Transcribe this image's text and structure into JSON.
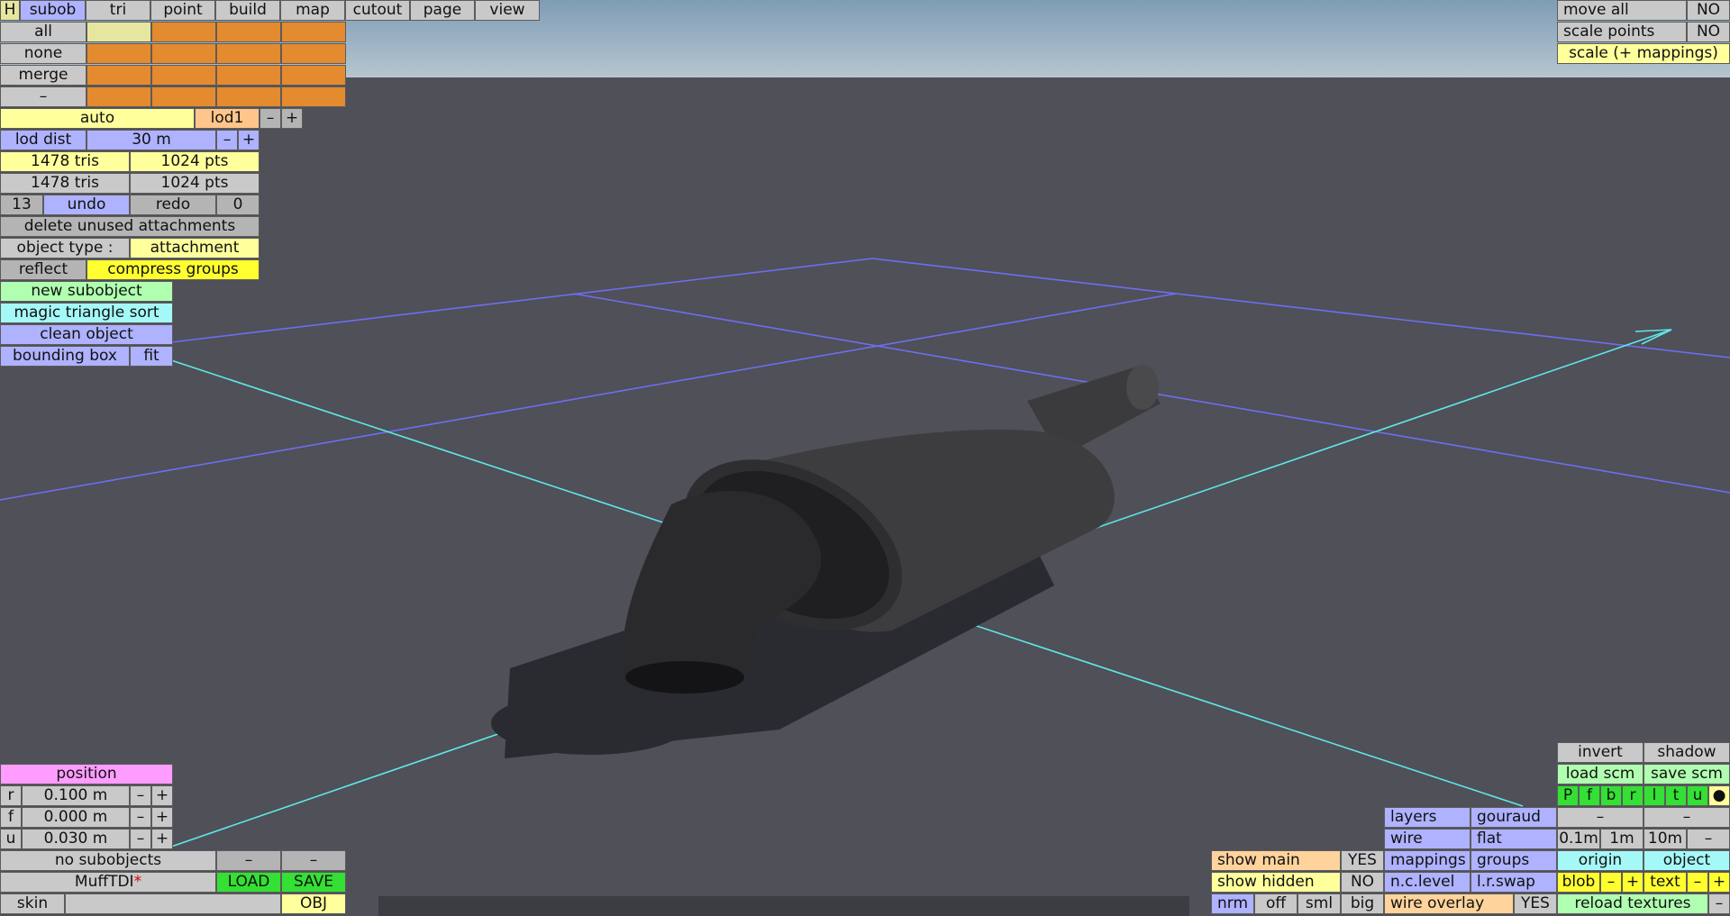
{
  "top_tabs": [
    "H",
    "subob",
    "tri",
    "point",
    "build",
    "map",
    "cutout",
    "page",
    "view"
  ],
  "select": {
    "all": "all",
    "none": "none",
    "merge": "merge",
    "minus": "–"
  },
  "lod": {
    "mode": "auto",
    "name": "lod1",
    "dec": "–",
    "inc": "+"
  },
  "lod_dist": {
    "label": "lod dist",
    "value": "30 m",
    "dec": "–",
    "inc": "+"
  },
  "stats": {
    "row1_tris": "1478 tris",
    "row1_pts": "1024 pts",
    "row2_tris": "1478 tris",
    "row2_pts": "1024 pts"
  },
  "history": {
    "undo_count": "13",
    "undo": "undo",
    "redo": "redo",
    "redo_count": "0"
  },
  "delete_unused": "delete unused attachments",
  "object_type": {
    "label": "object type :",
    "value": "attachment"
  },
  "reflect": "reflect",
  "compress": "compress groups",
  "new_subobject": "new subobject",
  "magic_sort": "magic triangle sort",
  "clean_object": "clean object",
  "bounding_box": "bounding box",
  "fit": "fit",
  "top_right": {
    "move_all": "move all",
    "move_all_val": "NO",
    "scale_points": "scale points",
    "scale_points_val": "NO",
    "scale_mappings": "scale (+ mappings)"
  },
  "position": {
    "title": "position",
    "rows": [
      {
        "axis": "r",
        "value": "0.100 m",
        "dec": "–",
        "inc": "+"
      },
      {
        "axis": "f",
        "value": "0.000 m",
        "dec": "–",
        "inc": "+"
      },
      {
        "axis": "u",
        "value": "0.030 m",
        "dec": "–",
        "inc": "+"
      }
    ]
  },
  "no_subobjects": "no subobjects",
  "dash": "–",
  "file": {
    "name": "MuffTDI",
    "modified": "*",
    "load": "LOAD",
    "save": "SAVE",
    "skin": "skin",
    "obj": "OBJ"
  },
  "br_left": {
    "show_main": "show main",
    "show_main_val": "YES",
    "show_hidden": "show hidden",
    "show_hidden_val": "NO",
    "nrm": "nrm",
    "off": "off",
    "sml": "sml",
    "big": "big"
  },
  "br_mid": {
    "layers": "layers",
    "gouraud": "gouraud",
    "wire": "wire",
    "flat": "flat",
    "mappings": "mappings",
    "groups": "groups",
    "nclevel": "n.c.level",
    "lrswap": "l.r.swap",
    "wire_overlay": "wire overlay",
    "wire_overlay_val": "YES"
  },
  "br_right": {
    "invert": "invert",
    "shadow": "shadow",
    "load_scm": "load scm",
    "save_scm": "save scm",
    "views": [
      "P",
      "f",
      "b",
      "r",
      "l",
      "t",
      "u",
      "●"
    ],
    "dash1": "–",
    "dash2": "–",
    "d01": "0.1m",
    "d1": "1m",
    "d10": "10m",
    "dmin": "–",
    "origin": "origin",
    "object": "object",
    "blob": "blob",
    "blob_dec": "–",
    "blob_inc": "+",
    "text": "text",
    "text_dec": "–",
    "text_inc": "+",
    "reload": "reload textures",
    "reload_dec": "–"
  }
}
